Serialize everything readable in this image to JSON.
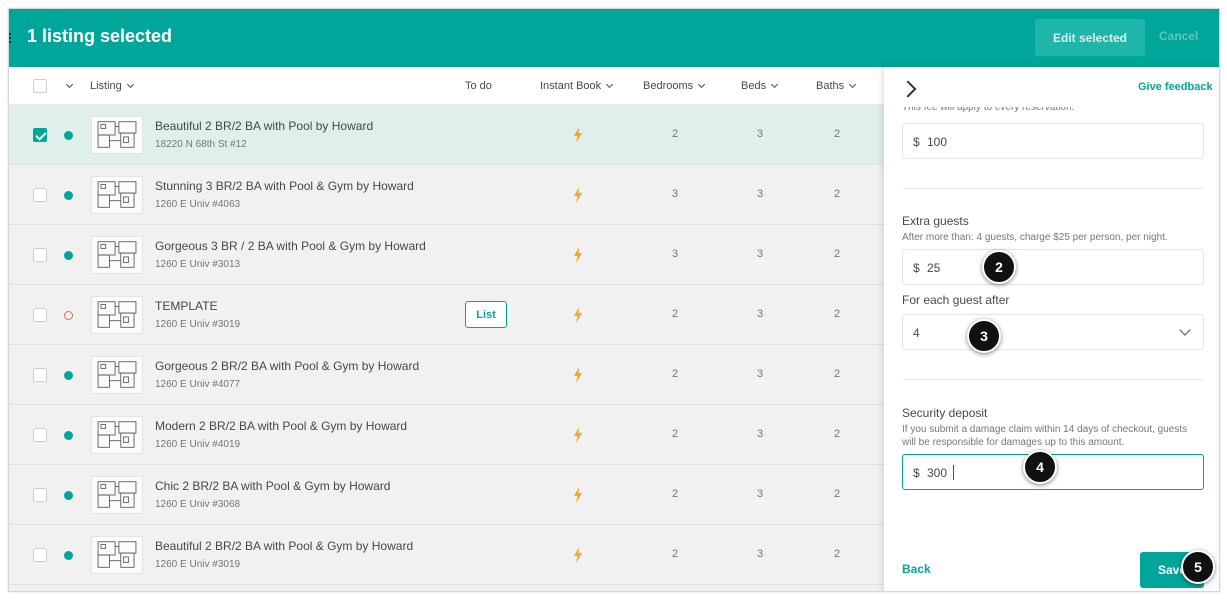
{
  "header": {
    "title": "1 listing selected",
    "edit_label": "Edit selected",
    "cancel_label": "Cancel"
  },
  "table": {
    "columns": {
      "listing": "Listing",
      "todo": "To do",
      "instant_book": "Instant Book",
      "bedrooms": "Bedrooms",
      "beds": "Beds",
      "baths": "Baths"
    },
    "list_label": "List",
    "rows": [
      {
        "name": "Beautiful 2 BR/2 BA with Pool by Howard",
        "address": "18220 N 68th St #12",
        "bedrooms": "2",
        "beds": "3",
        "baths": "2"
      },
      {
        "name": "Stunning 3 BR/2 BA with Pool & Gym by Howard",
        "address": "1260 E Univ #4063",
        "bedrooms": "3",
        "beds": "3",
        "baths": "2"
      },
      {
        "name": "Gorgeous 3 BR / 2 BA with Pool & Gym by Howard",
        "address": "1260 E Univ #3013",
        "bedrooms": "3",
        "beds": "3",
        "baths": "2"
      },
      {
        "name": "TEMPLATE",
        "address": "1260 E Univ #3019",
        "bedrooms": "2",
        "beds": "3",
        "baths": "2"
      },
      {
        "name": "Gorgeous 2 BR/2 BA with Pool & Gym by Howard",
        "address": "1260 E Univ #4077",
        "bedrooms": "2",
        "beds": "3",
        "baths": "2"
      },
      {
        "name": "Modern 2 BR/2 BA with Pool & Gym by Howard",
        "address": "1260 E Univ #4019",
        "bedrooms": "2",
        "beds": "3",
        "baths": "2"
      },
      {
        "name": "Chic 2 BR/2 BA with Pool & Gym by Howard",
        "address": "1260 E Univ #3068",
        "bedrooms": "2",
        "beds": "3",
        "baths": "2"
      },
      {
        "name": "Beautiful 2 BR/2 BA with Pool & Gym by Howard",
        "address": "1260 E Univ #3019",
        "bedrooms": "2",
        "beds": "3",
        "baths": "2"
      }
    ]
  },
  "panel": {
    "feedback_label": "Give feedback",
    "faded_text": "This fee will apply to every reservation.",
    "currency": "$",
    "cleaning_fee_value": "100",
    "extra_guests": {
      "title": "Extra guests",
      "description": "After more than: 4 guests, charge $25 per person, per night.",
      "value": "25"
    },
    "guest_after": {
      "title": "For each guest after",
      "value": "4"
    },
    "security_deposit": {
      "title": "Security deposit",
      "description": "If you submit a damage claim within 14 days of checkout, guests will be responsible for damages up to this amount.",
      "value": "300"
    },
    "back_label": "Back",
    "save_label": "Save"
  },
  "badges": [
    "2",
    "3",
    "4",
    "5"
  ],
  "colors": {
    "brand": "#00a699",
    "selected_row": "#deefec",
    "bolt": "#f5a623"
  }
}
